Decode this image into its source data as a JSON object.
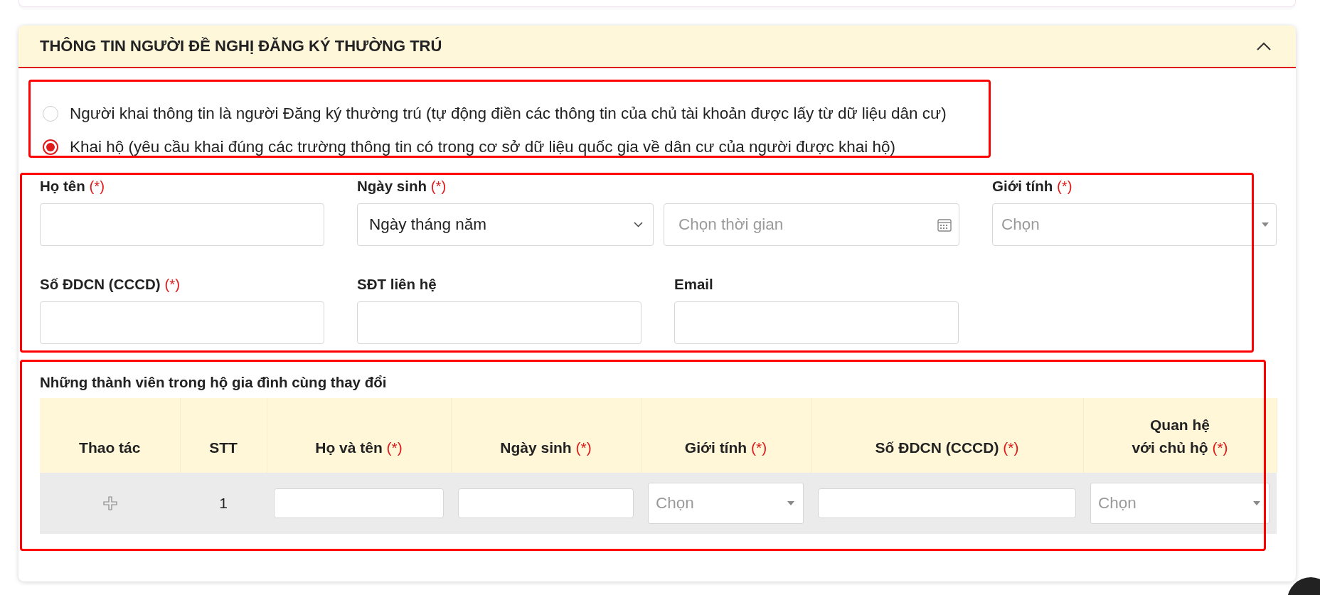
{
  "section": {
    "title": "THÔNG TIN NGƯỜI ĐỀ NGHỊ ĐĂNG KÝ THƯỜNG TRÚ",
    "expanded": true
  },
  "declarant_options": [
    {
      "label": "Người khai thông tin là người Đăng ký thường trú (tự động điền các thông tin của chủ tài khoản được lấy từ dữ liệu dân cư)",
      "selected": false
    },
    {
      "label": "Khai hộ (yêu cầu khai đúng các trường thông tin có trong cơ sở dữ liệu quốc gia về dân cư của người được khai hộ)",
      "selected": true
    }
  ],
  "field_rows": [
    [
      {
        "kind": "text",
        "label": "Họ tên",
        "marker": "(*)"
      },
      {
        "kind": "date",
        "label": "Ngày sinh",
        "marker": "(*)",
        "format_value": "Ngày tháng năm",
        "placeholder": "Chọn thời gian"
      },
      {
        "kind": "select",
        "label": "Giới tính",
        "marker": "(*)",
        "placeholder": "Chọn"
      }
    ],
    [
      {
        "kind": "text",
        "label": "Số ĐDCN (CCCD)",
        "marker": "(*)"
      },
      {
        "kind": "text",
        "label": "SĐT liên hệ"
      },
      {
        "kind": "text",
        "label": "Email"
      }
    ]
  ],
  "members": {
    "title": "Những thành viên trong hộ gia đình cùng thay đổi",
    "columns": [
      {
        "label": "Thao tác"
      },
      {
        "label": "STT"
      },
      {
        "label": "Họ và tên",
        "marker": "(*)"
      },
      {
        "label": "Ngày sinh",
        "marker": "(*)"
      },
      {
        "label": "Giới tính",
        "marker": "(*)"
      },
      {
        "label": "Số ĐDCN (CCCD)",
        "marker": "(*)"
      },
      {
        "label": "Quan hệ\nvới chủ hộ",
        "marker": "(*)"
      }
    ],
    "rows": [
      {
        "cells": [
          {
            "kind": "add"
          },
          {
            "kind": "text",
            "text": "1"
          },
          {
            "kind": "input"
          },
          {
            "kind": "input"
          },
          {
            "kind": "select",
            "placeholder": "Chọn"
          },
          {
            "kind": "input"
          },
          {
            "kind": "select",
            "placeholder": "Chọn"
          }
        ]
      }
    ]
  }
}
